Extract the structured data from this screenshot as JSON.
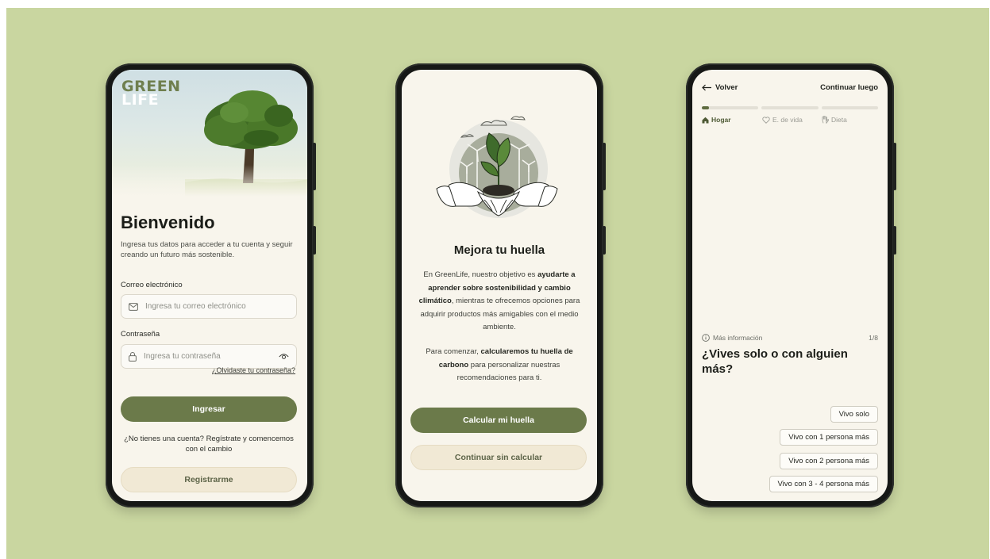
{
  "colors": {
    "background": "#c9d6a0",
    "primary": "#6b7a4a",
    "secondary": "#f1e9d5",
    "screen": "#f8f5ec"
  },
  "login": {
    "logo_line1": "GREEN",
    "logo_line2": "LIFE",
    "title": "Bienvenido",
    "subtitle": "Ingresa tus datos para acceder a tu cuenta y seguir creando un futuro más sostenible.",
    "email_label": "Correo electrónico",
    "email_placeholder": "Ingresa tu correo electrónico",
    "password_label": "Contraseña",
    "password_placeholder": "Ingresa tu contraseña",
    "forgot_link": "¿Olvidaste tu contraseña?",
    "login_button": "Ingresar",
    "no_account_text": "¿No tienes una cuenta? Regístrate y comencemos con el cambio",
    "register_button": "Registrarme"
  },
  "intro": {
    "title": "Mejora tu huella",
    "p1_a": "En GreenLife, nuestro objetivo es ",
    "p1_b": "ayudarte a aprender sobre sostenibilidad y cambio climático",
    "p1_c": ", mientras te ofrecemos opciones para adquirir productos más amigables con el medio ambiente.",
    "p2_a": "Para comenzar, ",
    "p2_b": "calcularemos tu huella de carbono",
    "p2_c": " para personalizar nuestras recomendaciones para ti.",
    "calc_button": "Calcular mi huella",
    "skip_button": "Continuar sin calcular"
  },
  "quiz": {
    "back_label": "Volver",
    "later_label": "Continuar luego",
    "progress": [
      0.12,
      0,
      0
    ],
    "steps": [
      {
        "label": "Hogar",
        "icon": "home-icon"
      },
      {
        "label": "E. de vida",
        "icon": "heart-icon"
      },
      {
        "label": "Dieta",
        "icon": "hand-icon"
      }
    ],
    "more_info": "Más información",
    "counter": "1/8",
    "question": "¿Vives solo o con alguien más?",
    "options": [
      "Vivo solo",
      "Vivo con 1 persona más",
      "Vivo con 2 persona más",
      "Vivo con 3 - 4 persona más"
    ]
  }
}
